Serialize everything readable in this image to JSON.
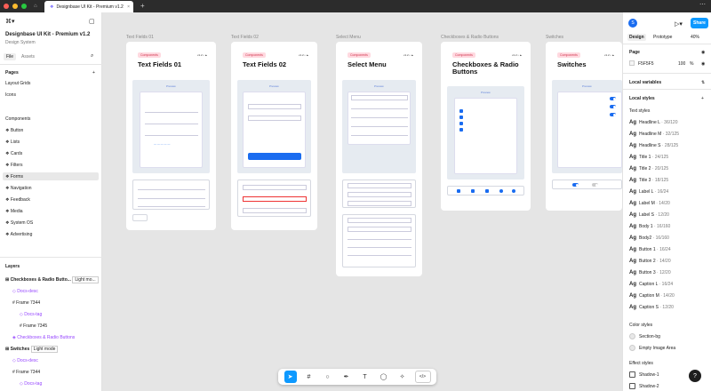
{
  "tab": {
    "title": "Designbase UI Kit - Premium v1.2"
  },
  "left": {
    "file_title": "Designbase UI Kit - Premium v1.2",
    "file_subtitle": "Design System",
    "tab_file": "File",
    "tab_assets": "Assets",
    "pages_header": "Pages",
    "pages": [
      "Layout Grids",
      "Icons"
    ],
    "components_header": "Components",
    "components": [
      "Button",
      "Lists",
      "Cards",
      "Filters",
      "Forms",
      "Navigation",
      "Feedback",
      "Media",
      "System OS",
      "Advertising"
    ],
    "layers_header": "Layers",
    "layers": [
      {
        "label": "Checkboxes & Radio Butto...",
        "tag": "Light mo..."
      },
      {
        "label": "Docs-desc"
      },
      {
        "label": "Frame 7344"
      },
      {
        "label": "Docs-tag"
      },
      {
        "label": "Frame 7345"
      },
      {
        "label": "Checkboxes & Radio Buttons"
      },
      {
        "label": "Switches",
        "tag": "Light mode"
      },
      {
        "label": "Docs-desc"
      },
      {
        "label": "Frame 7344"
      },
      {
        "label": "Docs-tag"
      }
    ]
  },
  "canvas": {
    "frames": [
      {
        "label": "Text Fields 01",
        "badge": "Components",
        "version": "v1.2 • ▲",
        "title": "Text Fields 01"
      },
      {
        "label": "Text Fields 02",
        "badge": "Components",
        "version": "v1.2 • ▲",
        "title": "Text Fields 02"
      },
      {
        "label": "Select Menu",
        "badge": "Components",
        "version": "v1.2 • ▲",
        "title": "Select Menu"
      },
      {
        "label": "Checkboxes & Radio Buttons",
        "badge": "Components",
        "version": "v1.2 • ▲",
        "title": "Checkboxes & Radio Buttons"
      },
      {
        "label": "Switches",
        "badge": "Components",
        "version": "v1.2 • ▲",
        "title": "Switches"
      }
    ],
    "preview_label": "Preview"
  },
  "toolbar": {
    "tools": [
      "move",
      "frame",
      "shape",
      "pen",
      "text",
      "comment",
      "actions",
      "dev-mode"
    ]
  },
  "right": {
    "user_initial": "S",
    "share_label": "Share",
    "tab_design": "Design",
    "tab_prototype": "Prototype",
    "zoom": "40%",
    "page_header": "Page",
    "page_color": "F5F5F5",
    "page_opacity": "100",
    "percent": "%",
    "local_variables": "Local variables",
    "local_styles": "Local styles",
    "text_styles_header": "Text styles",
    "text_styles": [
      {
        "name": "Headline L",
        "spec": "· 36/120"
      },
      {
        "name": "Headline M",
        "spec": "· 32/125"
      },
      {
        "name": "Headline S",
        "spec": "· 28/125"
      },
      {
        "name": "Title 1",
        "spec": "· 24/125"
      },
      {
        "name": "Title 2",
        "spec": "· 20/125"
      },
      {
        "name": "Title 3",
        "spec": "· 18/125"
      },
      {
        "name": "Label L",
        "spec": "· 16/24"
      },
      {
        "name": "Label M",
        "spec": "· 14/20"
      },
      {
        "name": "Label S",
        "spec": "· 12/20"
      },
      {
        "name": "Body 1",
        "spec": "· 16/160"
      },
      {
        "name": "Body2",
        "spec": "· 16/160"
      },
      {
        "name": "Button 1",
        "spec": "· 16/24"
      },
      {
        "name": "Button 2",
        "spec": "· 14/20"
      },
      {
        "name": "Button 3",
        "spec": "· 12/20"
      },
      {
        "name": "Caption L",
        "spec": "· 16/24"
      },
      {
        "name": "Caption M",
        "spec": "· 14/20"
      },
      {
        "name": "Caption S",
        "spec": "· 12/20"
      }
    ],
    "color_styles_header": "Color styles",
    "color_styles": [
      "Section-bg",
      "Empty Image Area"
    ],
    "effect_styles_header": "Effect styles",
    "effect_styles": [
      "Shadow-1",
      "Shadow-2"
    ],
    "help": "?"
  },
  "colors": {
    "accent": "#0d99ff",
    "badge_bg": "#ffd9e0",
    "badge_text": "#d0334c",
    "primary_blue": "#1a6cf0",
    "canvas_bg": "#e5e5e5"
  }
}
